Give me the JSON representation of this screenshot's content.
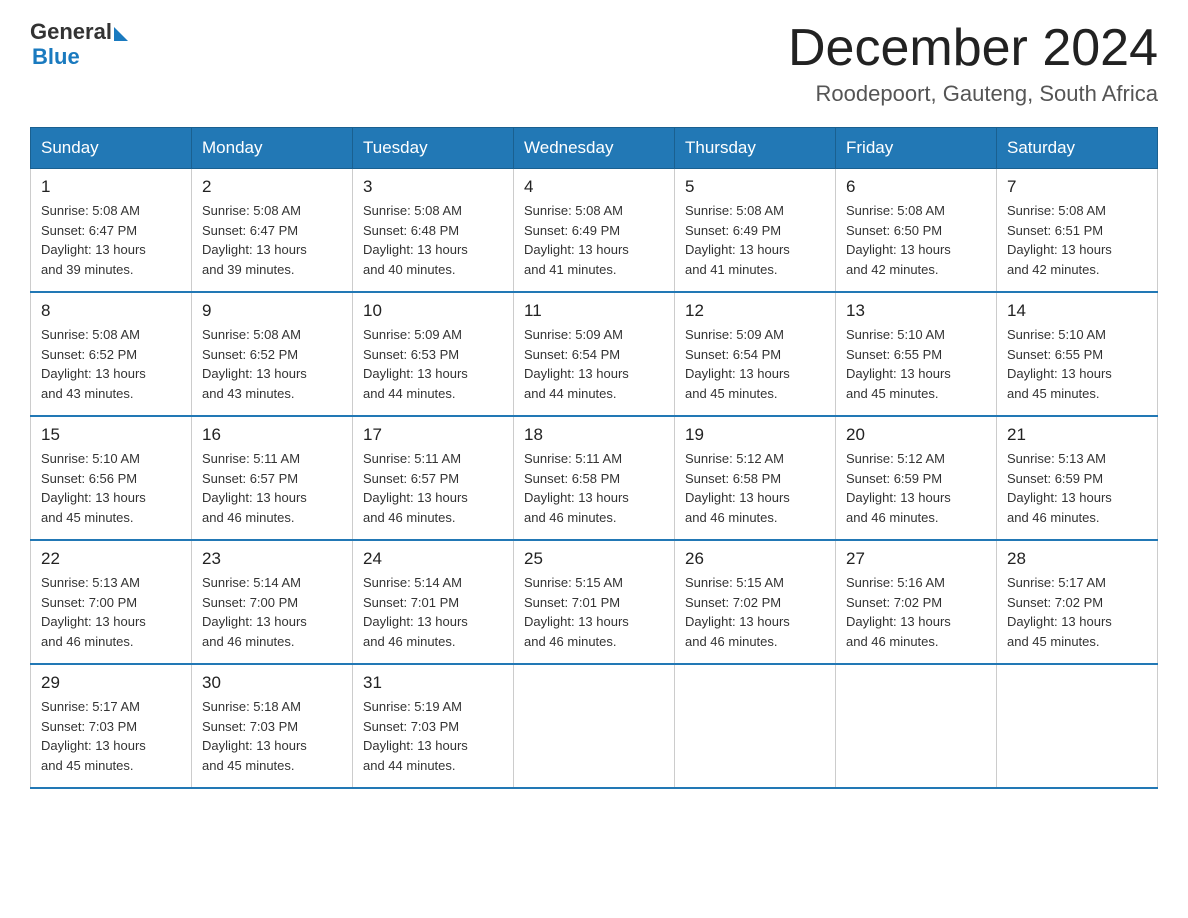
{
  "header": {
    "logo_line1": "General",
    "logo_line2": "Blue",
    "title": "December 2024",
    "subtitle": "Roodepoort, Gauteng, South Africa"
  },
  "days_of_week": [
    "Sunday",
    "Monday",
    "Tuesday",
    "Wednesday",
    "Thursday",
    "Friday",
    "Saturday"
  ],
  "weeks": [
    [
      {
        "day": "1",
        "sunrise": "5:08 AM",
        "sunset": "6:47 PM",
        "daylight": "13 hours and 39 minutes."
      },
      {
        "day": "2",
        "sunrise": "5:08 AM",
        "sunset": "6:47 PM",
        "daylight": "13 hours and 39 minutes."
      },
      {
        "day": "3",
        "sunrise": "5:08 AM",
        "sunset": "6:48 PM",
        "daylight": "13 hours and 40 minutes."
      },
      {
        "day": "4",
        "sunrise": "5:08 AM",
        "sunset": "6:49 PM",
        "daylight": "13 hours and 41 minutes."
      },
      {
        "day": "5",
        "sunrise": "5:08 AM",
        "sunset": "6:49 PM",
        "daylight": "13 hours and 41 minutes."
      },
      {
        "day": "6",
        "sunrise": "5:08 AM",
        "sunset": "6:50 PM",
        "daylight": "13 hours and 42 minutes."
      },
      {
        "day": "7",
        "sunrise": "5:08 AM",
        "sunset": "6:51 PM",
        "daylight": "13 hours and 42 minutes."
      }
    ],
    [
      {
        "day": "8",
        "sunrise": "5:08 AM",
        "sunset": "6:52 PM",
        "daylight": "13 hours and 43 minutes."
      },
      {
        "day": "9",
        "sunrise": "5:08 AM",
        "sunset": "6:52 PM",
        "daylight": "13 hours and 43 minutes."
      },
      {
        "day": "10",
        "sunrise": "5:09 AM",
        "sunset": "6:53 PM",
        "daylight": "13 hours and 44 minutes."
      },
      {
        "day": "11",
        "sunrise": "5:09 AM",
        "sunset": "6:54 PM",
        "daylight": "13 hours and 44 minutes."
      },
      {
        "day": "12",
        "sunrise": "5:09 AM",
        "sunset": "6:54 PM",
        "daylight": "13 hours and 45 minutes."
      },
      {
        "day": "13",
        "sunrise": "5:10 AM",
        "sunset": "6:55 PM",
        "daylight": "13 hours and 45 minutes."
      },
      {
        "day": "14",
        "sunrise": "5:10 AM",
        "sunset": "6:55 PM",
        "daylight": "13 hours and 45 minutes."
      }
    ],
    [
      {
        "day": "15",
        "sunrise": "5:10 AM",
        "sunset": "6:56 PM",
        "daylight": "13 hours and 45 minutes."
      },
      {
        "day": "16",
        "sunrise": "5:11 AM",
        "sunset": "6:57 PM",
        "daylight": "13 hours and 46 minutes."
      },
      {
        "day": "17",
        "sunrise": "5:11 AM",
        "sunset": "6:57 PM",
        "daylight": "13 hours and 46 minutes."
      },
      {
        "day": "18",
        "sunrise": "5:11 AM",
        "sunset": "6:58 PM",
        "daylight": "13 hours and 46 minutes."
      },
      {
        "day": "19",
        "sunrise": "5:12 AM",
        "sunset": "6:58 PM",
        "daylight": "13 hours and 46 minutes."
      },
      {
        "day": "20",
        "sunrise": "5:12 AM",
        "sunset": "6:59 PM",
        "daylight": "13 hours and 46 minutes."
      },
      {
        "day": "21",
        "sunrise": "5:13 AM",
        "sunset": "6:59 PM",
        "daylight": "13 hours and 46 minutes."
      }
    ],
    [
      {
        "day": "22",
        "sunrise": "5:13 AM",
        "sunset": "7:00 PM",
        "daylight": "13 hours and 46 minutes."
      },
      {
        "day": "23",
        "sunrise": "5:14 AM",
        "sunset": "7:00 PM",
        "daylight": "13 hours and 46 minutes."
      },
      {
        "day": "24",
        "sunrise": "5:14 AM",
        "sunset": "7:01 PM",
        "daylight": "13 hours and 46 minutes."
      },
      {
        "day": "25",
        "sunrise": "5:15 AM",
        "sunset": "7:01 PM",
        "daylight": "13 hours and 46 minutes."
      },
      {
        "day": "26",
        "sunrise": "5:15 AM",
        "sunset": "7:02 PM",
        "daylight": "13 hours and 46 minutes."
      },
      {
        "day": "27",
        "sunrise": "5:16 AM",
        "sunset": "7:02 PM",
        "daylight": "13 hours and 46 minutes."
      },
      {
        "day": "28",
        "sunrise": "5:17 AM",
        "sunset": "7:02 PM",
        "daylight": "13 hours and 45 minutes."
      }
    ],
    [
      {
        "day": "29",
        "sunrise": "5:17 AM",
        "sunset": "7:03 PM",
        "daylight": "13 hours and 45 minutes."
      },
      {
        "day": "30",
        "sunrise": "5:18 AM",
        "sunset": "7:03 PM",
        "daylight": "13 hours and 45 minutes."
      },
      {
        "day": "31",
        "sunrise": "5:19 AM",
        "sunset": "7:03 PM",
        "daylight": "13 hours and 44 minutes."
      },
      null,
      null,
      null,
      null
    ]
  ],
  "labels": {
    "sunrise": "Sunrise:",
    "sunset": "Sunset:",
    "daylight": "Daylight:"
  }
}
